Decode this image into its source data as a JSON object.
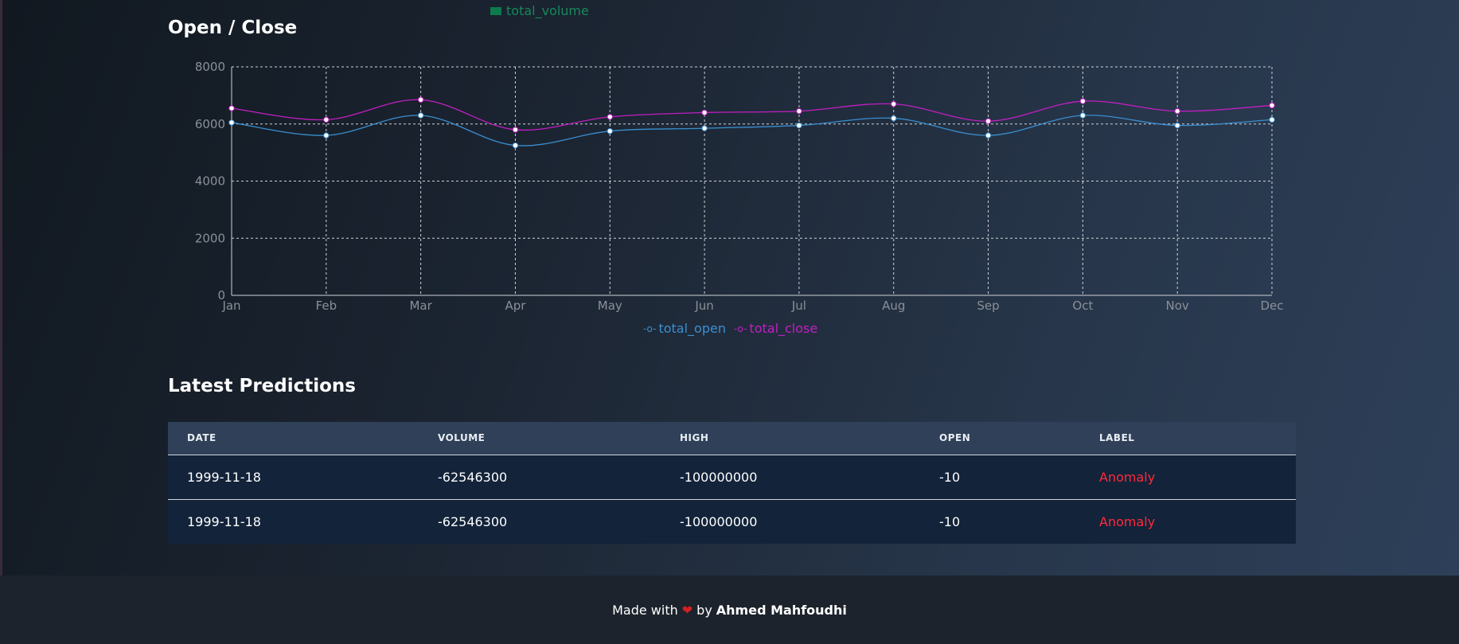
{
  "top_legend": {
    "label": "total_volume",
    "color": "#0d7a4e"
  },
  "chart_section": {
    "title": "Open / Close"
  },
  "chart_data": {
    "type": "line",
    "title": "",
    "xlabel": "",
    "ylabel": "",
    "categories": [
      "Jan",
      "Feb",
      "Mar",
      "Apr",
      "May",
      "Jun",
      "Jul",
      "Aug",
      "Sep",
      "Oct",
      "Nov",
      "Dec"
    ],
    "ylim": [
      0,
      8000
    ],
    "yticks": [
      "0",
      "2000",
      "4000",
      "6000",
      "8000"
    ],
    "grid": true,
    "legend_position": "bottom",
    "series": [
      {
        "name": "total_open",
        "color": "#3a8fd0",
        "values": [
          6050,
          5600,
          6300,
          5250,
          5750,
          5850,
          5950,
          6200,
          5600,
          6300,
          5950,
          6150
        ]
      },
      {
        "name": "total_close",
        "color": "#c21ec2",
        "values": [
          6550,
          6150,
          6850,
          5800,
          6250,
          6400,
          6450,
          6700,
          6100,
          6800,
          6450,
          6650
        ]
      }
    ]
  },
  "predictions": {
    "title": "Latest Predictions",
    "columns": [
      "DATE",
      "VOLUME",
      "HIGH",
      "OPEN",
      "LABEL"
    ],
    "rows": [
      [
        "1999-11-18",
        "-62546300",
        "-100000000",
        "-10",
        "Anomaly"
      ],
      [
        "1999-11-18",
        "-62546300",
        "-100000000",
        "-10",
        "Anomaly"
      ]
    ]
  },
  "footer": {
    "prefix": "Made with",
    "by": "by",
    "author": "Ahmed Mahfoudhi"
  }
}
